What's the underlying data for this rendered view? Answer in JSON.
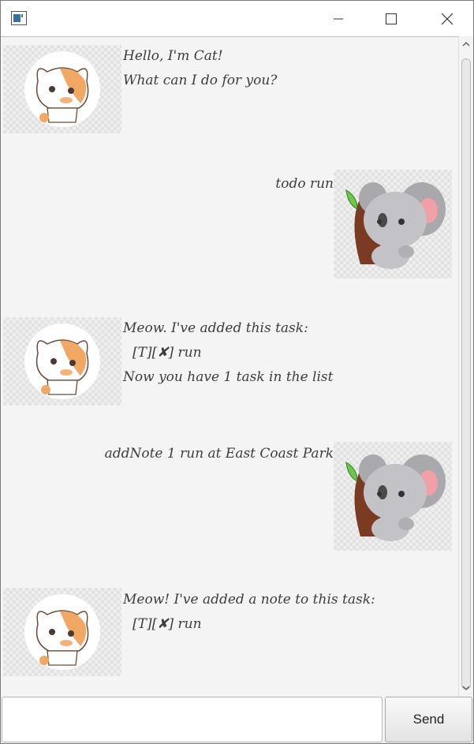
{
  "window": {
    "title": ""
  },
  "conversation": [
    {
      "sender": "bot",
      "avatar": "cat-avatar",
      "lines": [
        "Hello, I'm Cat!",
        "What can I do for you?"
      ]
    },
    {
      "sender": "user",
      "avatar": "koala-avatar",
      "lines": [
        "todo run"
      ]
    },
    {
      "sender": "bot",
      "avatar": "cat-avatar",
      "lines": [
        "Meow. I've added this task:",
        "[T][✘] run",
        "Now you have 1 task in the list"
      ]
    },
    {
      "sender": "user",
      "avatar": "koala-avatar",
      "lines": [
        "addNote 1 run at East Coast Park"
      ]
    },
    {
      "sender": "bot",
      "avatar": "cat-avatar",
      "lines": [
        "Meow! I've added a note to this task:",
        "[T][✘] run"
      ]
    }
  ],
  "input": {
    "value": "",
    "placeholder": ""
  },
  "send_label": "Send",
  "colors": {
    "chat_background": "#f4f4f4",
    "text": "#3c3c3c"
  }
}
